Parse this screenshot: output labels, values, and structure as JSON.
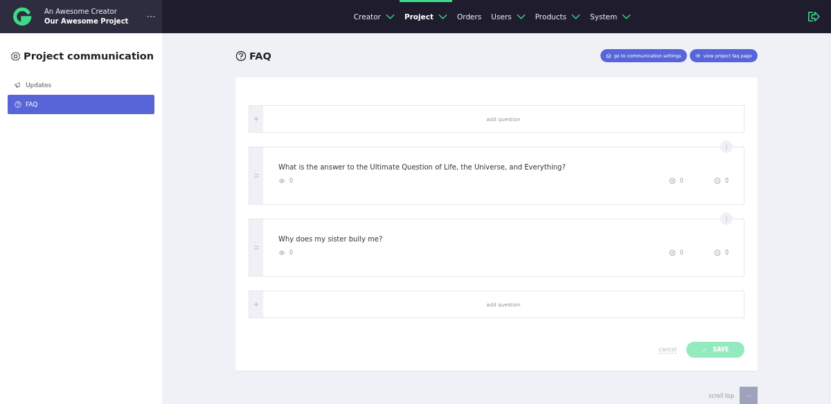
{
  "header": {
    "creator": "An Awesome Creator",
    "project": "Our Awesome Project",
    "nav": [
      {
        "label": "Creator",
        "dropdown": true,
        "selected": false
      },
      {
        "label": "Project",
        "dropdown": true,
        "selected": true
      },
      {
        "label": "Orders",
        "dropdown": false,
        "selected": false
      },
      {
        "label": "Users",
        "dropdown": true,
        "selected": false
      },
      {
        "label": "Products",
        "dropdown": true,
        "selected": false
      },
      {
        "label": "System",
        "dropdown": true,
        "selected": false
      }
    ]
  },
  "sidebar": {
    "title": "Project communication",
    "items": [
      {
        "label": "Updates",
        "selected": false
      },
      {
        "label": "FAQ",
        "selected": true
      }
    ]
  },
  "page": {
    "title": "FAQ",
    "actions": [
      {
        "label": "go to communication settings"
      },
      {
        "label": "view project faq page"
      }
    ],
    "items": [
      {
        "kind": "add",
        "label": "add question"
      },
      {
        "kind": "question",
        "text": "What is the answer to the Ultimate Question of Life, the Universe, and Everything?",
        "views": "0",
        "rejected": "0",
        "accepted": "0"
      },
      {
        "kind": "question",
        "text": "Why does my sister bully me?",
        "views": "0",
        "rejected": "0",
        "accepted": "0"
      },
      {
        "kind": "add",
        "label": "add question"
      }
    ],
    "cancel": "cancel",
    "save": {
      "label": "SAVE",
      "disabled": true
    },
    "scroll_top": "scroll top"
  }
}
